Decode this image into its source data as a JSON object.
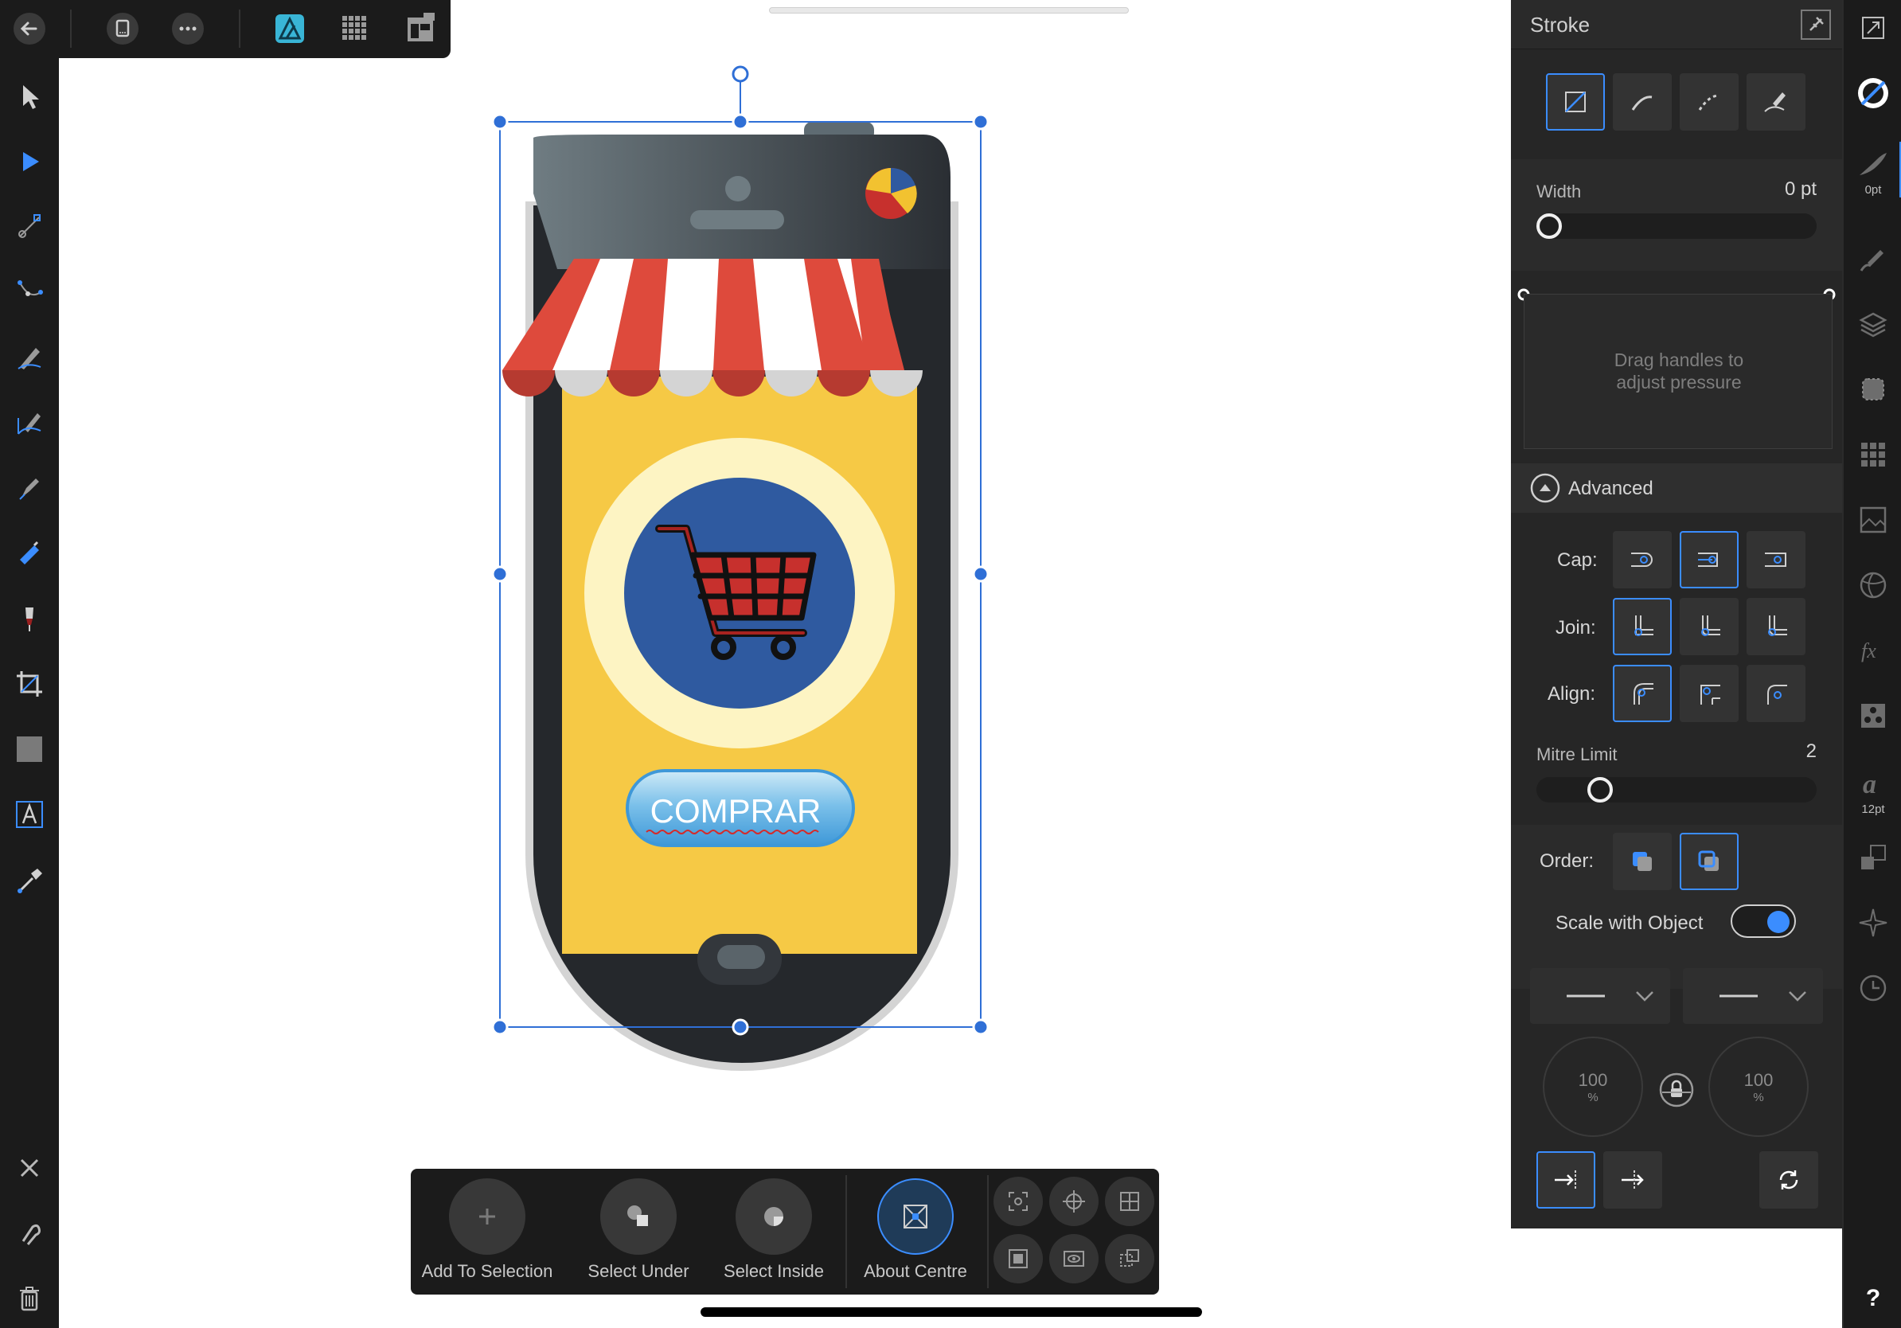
{
  "top_toolbar": {
    "items": [
      "back-icon",
      "document-icon",
      "more-icon",
      "designer-persona-icon",
      "pixel-persona-icon",
      "export-persona-icon"
    ]
  },
  "left_tools": [
    "move-tool-icon",
    "node-tool-icon",
    "corner-tool-icon",
    "point-transform-icon",
    "pencil-tool-icon",
    "vector-brush-icon",
    "pen-tool-icon",
    "fill-tool-icon",
    "transparency-tool-icon",
    "crop-tool-icon",
    "shape-tool-icon",
    "text-tool-icon",
    "color-picker-icon"
  ],
  "left_bottom": [
    "close-icon",
    "snapping-icon",
    "trash-icon"
  ],
  "artwork": {
    "button_text": "COMPRAR",
    "colors": {
      "screen": "#f6c945",
      "phone_body": "#25282c",
      "phone_rim": "#d4d4d4",
      "awning_red": "#de4a3c",
      "cart_circle": "#2f5aa0",
      "cart_glow": "#fdf4c3",
      "button_blue": "#4aa6e0",
      "selection": "#2f6fd6"
    }
  },
  "stroke_panel": {
    "title": "Stroke",
    "style_buttons": [
      "no-stroke-icon",
      "solid-line-icon",
      "dashed-line-icon",
      "brush-stroke-icon"
    ],
    "width_label": "Width",
    "width_value": "0 pt",
    "width_fraction": 0,
    "pressure_hint_line1": "Drag handles to",
    "pressure_hint_line2": "adjust pressure",
    "advanced_label": "Advanced",
    "cap_label": "Cap:",
    "join_label": "Join:",
    "align_label": "Align:",
    "mitre_label": "Mitre Limit",
    "mitre_value": "2",
    "order_label": "Order:",
    "scale_label": "Scale with Object",
    "scale_on": true,
    "dial_left_value": "100",
    "dial_left_unit": "%",
    "dial_right_value": "100",
    "dial_right_unit": "%"
  },
  "studio_strip": {
    "stroke_width_label": "0pt",
    "text_size_label": "12pt",
    "help_label": "?"
  },
  "context_bar": {
    "add_to_selection": "Add To Selection",
    "select_under": "Select Under",
    "select_inside": "Select Inside",
    "about_centre": "About Centre"
  }
}
